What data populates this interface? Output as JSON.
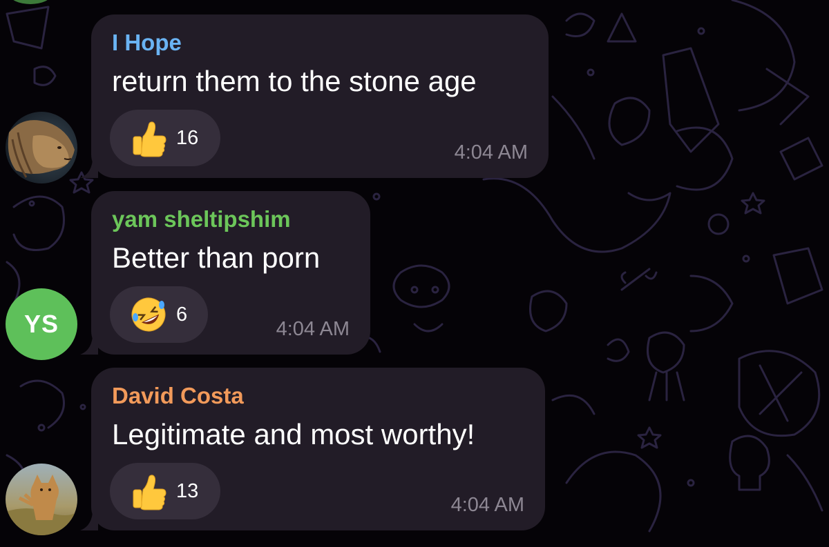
{
  "colors": {
    "background": "#050307",
    "bubble": "#221c27",
    "reaction_pill": "#352e3b",
    "message_text": "#ffffff",
    "timestamp": "#8d8793",
    "avatar_ys": "#5ec05a"
  },
  "messages": [
    {
      "sender": "I Hope",
      "sender_color": "#6ab3f3",
      "text": "return them to the stone age",
      "reaction_icon": "thumbs-up-icon",
      "reaction_count": "16",
      "time": "4:04 AM",
      "avatar": {
        "type": "image",
        "icon": "lion-avatar-icon"
      }
    },
    {
      "sender": "yam sheltipshim",
      "sender_color": "#6cc65a",
      "text": "Better than porn",
      "reaction_icon": "rolling-laughing-icon",
      "reaction_count": "6",
      "time": "4:04 AM",
      "avatar": {
        "type": "initials",
        "initials": "YS"
      }
    },
    {
      "sender": "David Costa",
      "sender_color": "#f29a5a",
      "text": "Legitimate and most worthy!",
      "reaction_icon": "thumbs-up-icon",
      "reaction_count": "13",
      "time": "4:04 AM",
      "avatar": {
        "type": "image",
        "icon": "caracal-avatar-icon"
      }
    }
  ]
}
